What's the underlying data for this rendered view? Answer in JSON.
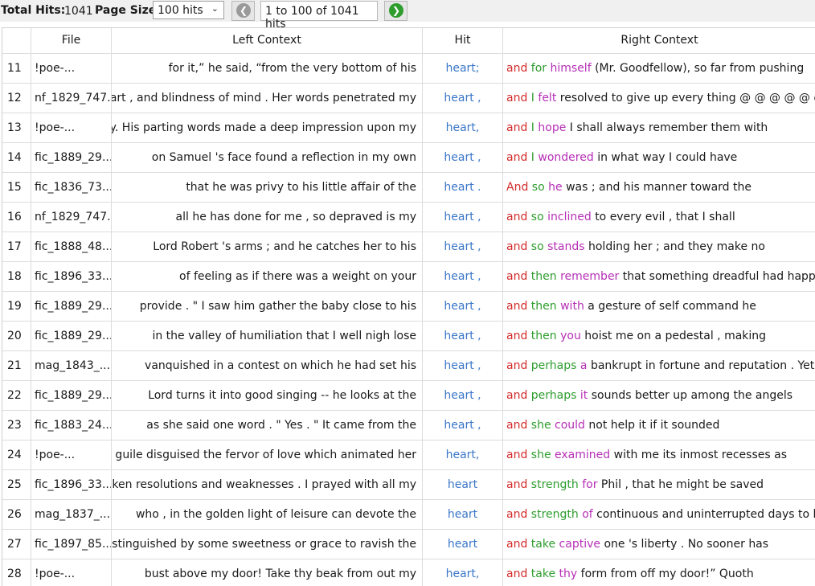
{
  "toolbar": {
    "total_hits_label": "Total Hits:",
    "total_hits_value": "1041",
    "page_size_label": "Page Size",
    "page_size_selected": "100 hits",
    "prev_icon": "arrow-left-circle-icon",
    "next_icon": "arrow-right-circle-icon",
    "range_text": "1 to 100 of 1041 hits",
    "prev_color": "#9a9a9a",
    "next_color": "#2e9d2e"
  },
  "table": {
    "columns": [
      "",
      "File",
      "Left Context",
      "Hit",
      "Right Context"
    ],
    "colors": {
      "hit": "#3a76c8",
      "right_word1": "#d32a2a",
      "right_word2": "#2e9d2e",
      "right_word3": "#b62fb6"
    },
    "rows": [
      {
        "num": "11",
        "file": "!poe-...",
        "left": "for it,” he said, “from the very bottom of his",
        "hit": "heart;",
        "r1": "and",
        "r2": "for",
        "r3": "himself",
        "rest": "(Mr. Goodfellow), so far from pushing"
      },
      {
        "num": "12",
        "file": "nf_1829_747...",
        "left": "heart , and blindness of mind . Her words penetrated my",
        "hit": "heart ,",
        "r1": "and",
        "r2": "I",
        "r3": "felt",
        "rest": "resolved to give up every thing @ @ @ @ @ @ @"
      },
      {
        "num": "13",
        "file": "!poe-...",
        "left": "ility. His parting words made a deep impression upon my",
        "hit": "heart,",
        "r1": "and",
        "r2": "I",
        "r3": "hope",
        "rest": "I shall always remember them with"
      },
      {
        "num": "14",
        "file": "fic_1889_29...",
        "left": "on Samuel 's face found a reflection in my own",
        "hit": "heart ,",
        "r1": "and",
        "r2": "I",
        "r3": "wondered",
        "rest": "in what way I could have"
      },
      {
        "num": "15",
        "file": "fic_1836_73...",
        "left": "that he was privy to his little affair of the",
        "hit": "heart .",
        "r1": "And",
        "r2": "so",
        "r3": "he",
        "rest": "was ; and his manner toward the"
      },
      {
        "num": "16",
        "file": "nf_1829_747...",
        "left": "all he has done for me , so depraved is my",
        "hit": "heart ,",
        "r1": "and",
        "r2": "so",
        "r3": "inclined",
        "rest": "to every evil , that I shall"
      },
      {
        "num": "17",
        "file": "fic_1888_48...",
        "left": "Lord Robert 's arms ; and he catches her to his",
        "hit": "heart ,",
        "r1": "and",
        "r2": "so",
        "r3": "stands",
        "rest": "holding her ; and they make no"
      },
      {
        "num": "18",
        "file": "fic_1896_33...",
        "left": "of feeling as if there was a weight on your",
        "hit": "heart ,",
        "r1": "and",
        "r2": "then",
        "r3": "remember",
        "rest": "that something dreadful had happened"
      },
      {
        "num": "19",
        "file": "fic_1889_29...",
        "left": "provide . \" I saw him gather the baby close to his",
        "hit": "heart ,",
        "r1": "and",
        "r2": "then",
        "r3": "with",
        "rest": "a gesture of self command he"
      },
      {
        "num": "20",
        "file": "fic_1889_29...",
        "left": "in the valley of humiliation that I well nigh lose",
        "hit": "heart ,",
        "r1": "and",
        "r2": "then",
        "r3": "you",
        "rest": "hoist me on a pedestal , making"
      },
      {
        "num": "21",
        "file": "mag_1843_...",
        "left": "vanquished in a contest on which he had set his",
        "hit": "heart ,",
        "r1": "and",
        "r2": "perhaps",
        "r3": "a",
        "rest": "bankrupt in fortune and reputation . Yet"
      },
      {
        "num": "22",
        "file": "fic_1889_29...",
        "left": "Lord turns it into good singing -- he looks at the",
        "hit": "heart ,",
        "r1": "and",
        "r2": "perhaps",
        "r3": "it",
        "rest": "sounds better up among the angels"
      },
      {
        "num": "23",
        "file": "fic_1883_24...",
        "left": "as she said one word . \" Yes . \" It came from the",
        "hit": "heart ,",
        "r1": "and",
        "r2": "she",
        "r3": "could",
        "rest": "not help it if it sounded"
      },
      {
        "num": "24",
        "file": "!poe-...",
        "left": "No guile disguised the fervor of love which animated her",
        "hit": "heart,",
        "r1": "and",
        "r2": "she",
        "r3": "examined",
        "rest": "with me its inmost recesses as"
      },
      {
        "num": "25",
        "file": "fic_1896_33...",
        "left": "broken resolutions and weaknesses . I prayed with all my",
        "hit": "heart",
        "r1": "and",
        "r2": "strength",
        "r3": "for",
        "rest": "Phil , that he might be saved"
      },
      {
        "num": "26",
        "file": "mag_1837_...",
        "left": "who , in the golden light of leisure can devote the",
        "hit": "heart",
        "r1": "and",
        "r2": "strength",
        "r3": "of",
        "rest": "continuous and uninterrupted days to his"
      },
      {
        "num": "27",
        "file": "fic_1897_85...",
        "left": "ch distinguished by some sweetness or grace to ravish the",
        "hit": "heart",
        "r1": "and",
        "r2": "take",
        "r3": "captive",
        "rest": "one 's liberty . No sooner has"
      },
      {
        "num": "28",
        "file": "!poe-...",
        "left": "bust above my door! Take thy beak from out my",
        "hit": "heart,",
        "r1": "and",
        "r2": "take",
        "r3": "thy",
        "rest": "form from off my door!” Quoth"
      }
    ]
  }
}
